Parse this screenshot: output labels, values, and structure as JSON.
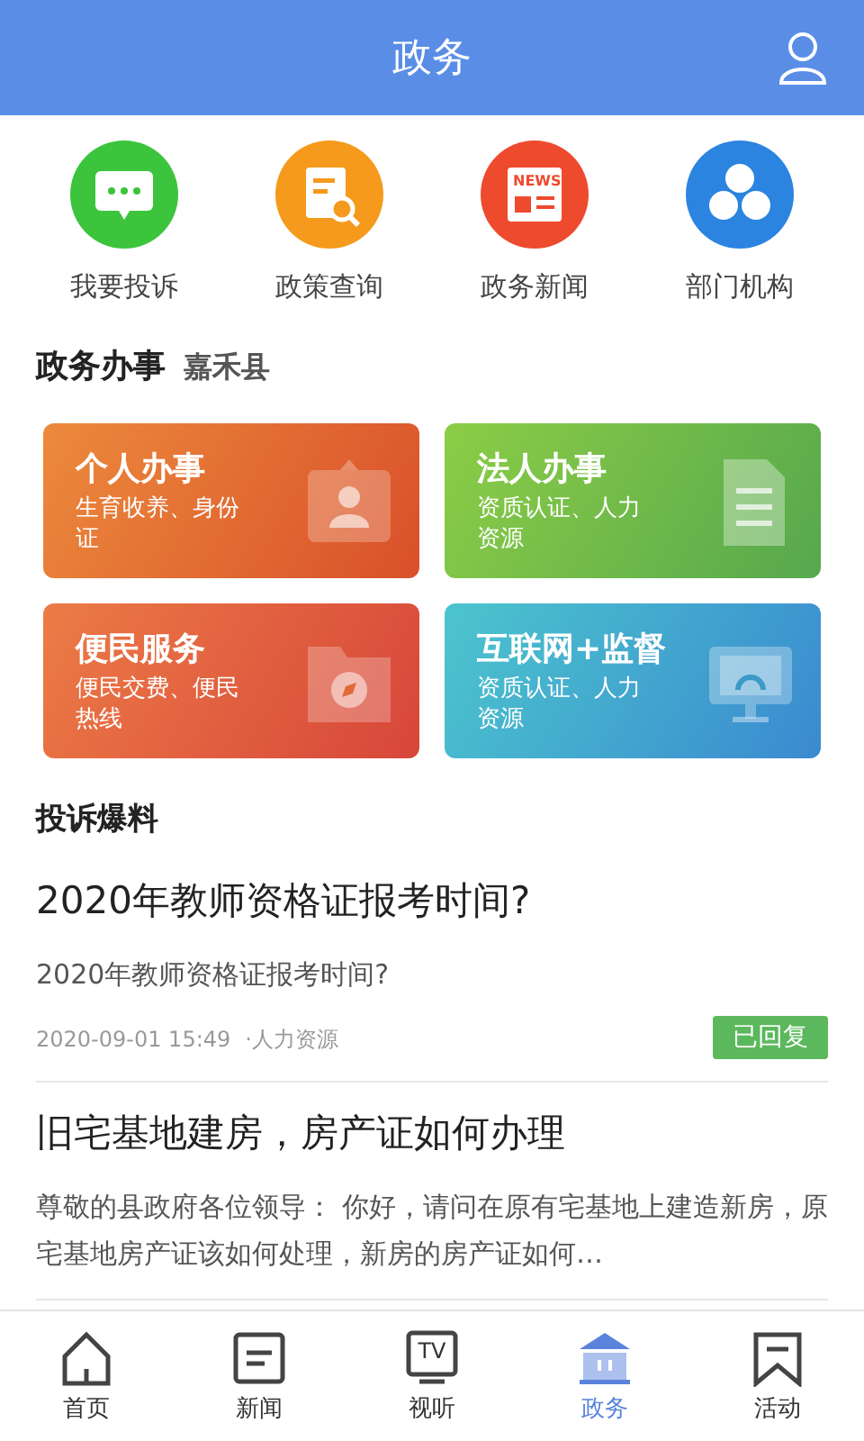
{
  "header": {
    "title": "政务"
  },
  "quick_links": [
    {
      "kind": "chat",
      "label": "我要投诉"
    },
    {
      "kind": "search",
      "label": "政策查询"
    },
    {
      "kind": "news",
      "label": "政务新闻",
      "icon_text": "NEWS"
    },
    {
      "kind": "org",
      "label": "部门机构"
    }
  ],
  "affairs": {
    "title": "政务办事",
    "region": "嘉禾县",
    "cards": [
      {
        "kind": "person",
        "title": "个人办事",
        "subtitle": "生育收养、身份证"
      },
      {
        "kind": "document",
        "title": "法人办事",
        "subtitle": "资质认证、人力资源"
      },
      {
        "kind": "compass",
        "title": "便民服务",
        "subtitle": "便民交费、便民热线"
      },
      {
        "kind": "monitor",
        "title": "互联网+监督",
        "subtitle": "资质认证、人力资源"
      }
    ]
  },
  "complaints": {
    "title": "投诉爆料",
    "items": [
      {
        "title": "2020年教师资格证报考时间?",
        "summary": "2020年教师资格证报考时间?",
        "time": "2020-09-01 15:49",
        "category": "·人力资源",
        "status": "已回复"
      },
      {
        "title": "旧宅基地建房，房产证如何办理",
        "summary": "尊敬的县政府各位领导：  你好，请问在原有宅基地上建造新房，原宅基地房产证该如何处理，新房的房产证如何…"
      }
    ]
  },
  "tabs": [
    {
      "kind": "home",
      "label": "首页",
      "selected": false
    },
    {
      "kind": "news",
      "label": "新闻",
      "selected": false
    },
    {
      "kind": "tv",
      "label": "视听",
      "selected": false,
      "icon_text": "TV"
    },
    {
      "kind": "gov",
      "label": "政务",
      "selected": true
    },
    {
      "kind": "flag",
      "label": "活动",
      "selected": false
    }
  ]
}
